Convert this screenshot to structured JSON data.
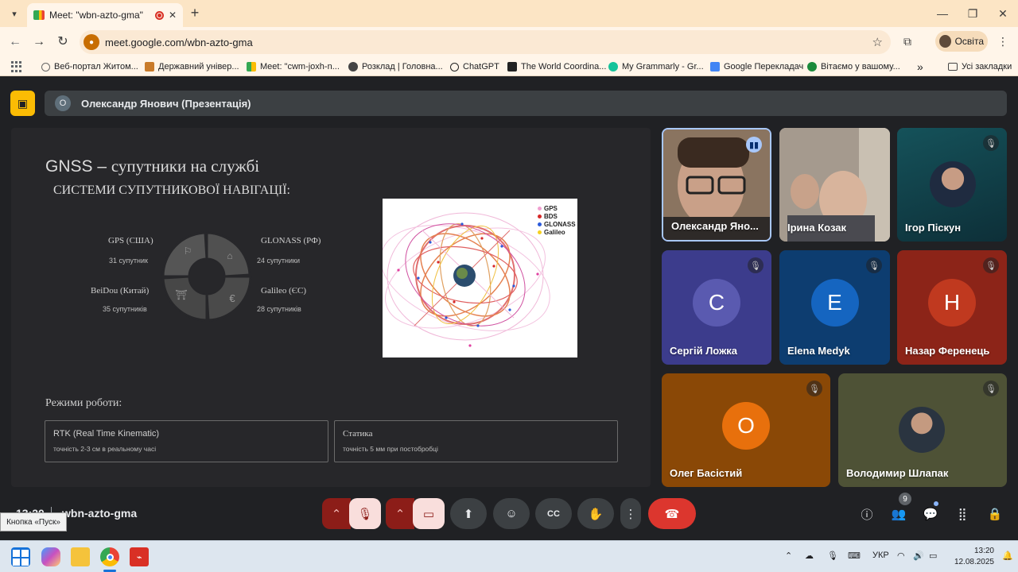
{
  "browser": {
    "tab_title": "Meet: \"wbn-azto-gma\"",
    "url": "meet.google.com/wbn-azto-gma",
    "profile_name": "Освіта",
    "bookmarks": [
      "Веб-портал Житом...",
      "Державний універ...",
      "Meet: \"cwm-joxh-n...",
      "Розклад | Головна...",
      "ChatGPT",
      "The World Coordina...",
      "My Grammarly - Gr...",
      "Google Перекладач",
      "Вітаємо у вашому..."
    ],
    "all_bookmarks": "Усі закладки"
  },
  "meet": {
    "presenter_initial": "О",
    "presenter_label": "Олександр Янович (Презентація)",
    "meeting_code": "wbn-azto-gma",
    "time_partial": "13:20",
    "people_count": "9",
    "tooltip": "Кнопка «Пуск»"
  },
  "slide": {
    "title_prefix": "GNSS – ",
    "title_rest": "супутники на службі",
    "subtitle": "СИСТЕМИ СУПУТНИКОВОЇ НАВІГАЦІЇ:",
    "systems": [
      {
        "name": "GPS (США)",
        "count": "31 супутник"
      },
      {
        "name": "GLONASS (РФ)",
        "count": "24 супутники"
      },
      {
        "name": "BeiDou (Китай)",
        "count": "35 супутників"
      },
      {
        "name": "Galileo (ЄС)",
        "count": "28 супутників"
      }
    ],
    "legend": [
      "GPS",
      "BDS",
      "GLONASS",
      "Galileo"
    ],
    "modes_title": "Режими роботи:",
    "modes": [
      {
        "title": "RTK (Real Time Kinematic)",
        "desc": "точність 2-3 см в реальному часі"
      },
      {
        "title": "Статика",
        "desc": "точність 5 мм при постобробці"
      }
    ]
  },
  "participants": [
    {
      "name": "Олександр Яно...",
      "type": "video"
    },
    {
      "name": "Ірина Козак",
      "type": "video"
    },
    {
      "name": "Ігор Піскун",
      "type": "avatar-photo"
    },
    {
      "name": "Сергій Ложка",
      "letter": "С"
    },
    {
      "name": "Elena Medyk",
      "letter": "E"
    },
    {
      "name": "Назар Ференець",
      "letter": "Н"
    },
    {
      "name": "Олег Басістий",
      "letter": "О"
    },
    {
      "name": "Володимир Шлапак",
      "type": "avatar-photo"
    }
  ],
  "taskbar": {
    "lang": "УКР",
    "time": "13:20",
    "date": "12.08.2025"
  }
}
